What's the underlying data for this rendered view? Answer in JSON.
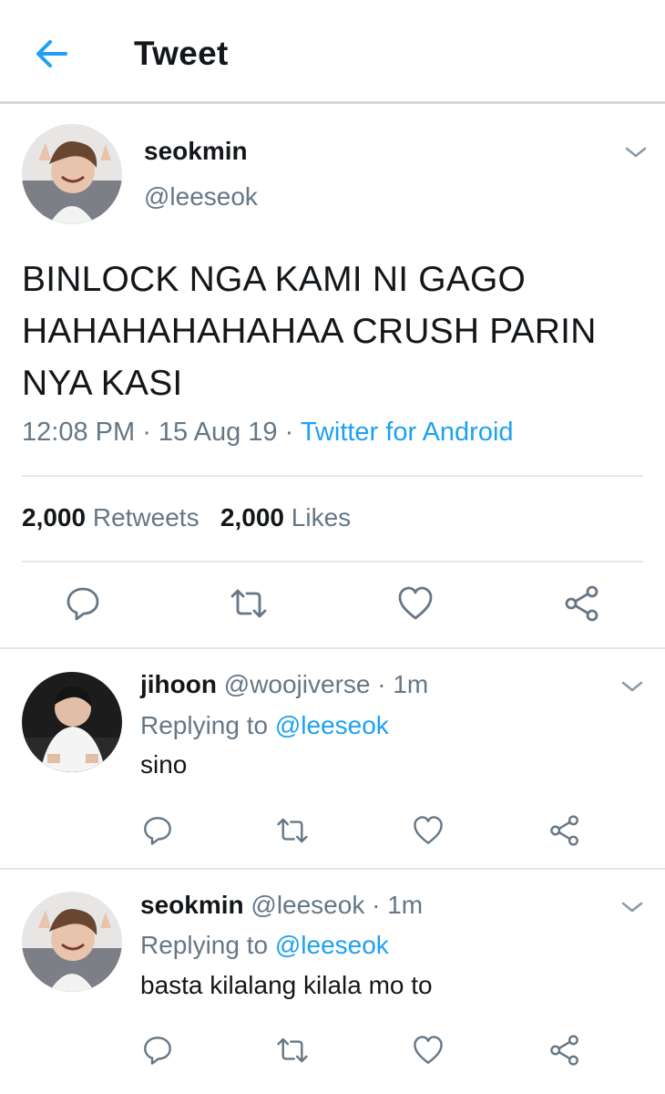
{
  "header": {
    "title": "Tweet",
    "back_icon": "arrow-left-icon",
    "accent": "#1da1f2"
  },
  "tweet": {
    "name": "seokmin",
    "handle": "@leeseok",
    "text": "BINLOCK NGA KAMI NI GAGO HAHAHAHAHAHAA CRUSH PARIN NYA KASI",
    "time": "12:08 PM",
    "dot1": " · ",
    "date": "15 Aug 19",
    "dot2": " · ",
    "source": "Twitter for Android",
    "retweets_count": "2,000",
    "retweets_label": "Retweets",
    "likes_count": "2,000",
    "likes_label": "Likes"
  },
  "replies": [
    {
      "name": "jihoon",
      "handle": "@woojiverse",
      "sep": " · ",
      "time": "1m",
      "replying_prefix": "Replying to ",
      "replying_to": "@leeseok",
      "text": "sino"
    },
    {
      "name": "seokmin",
      "handle": "@leeseok",
      "sep": " · ",
      "time": "1m",
      "replying_prefix": "Replying to ",
      "replying_to": "@leeseok",
      "text": "basta kilalang kilala mo to"
    }
  ],
  "icons": [
    "reply-icon",
    "retweet-icon",
    "like-icon",
    "share-icon",
    "chevron-down-icon"
  ]
}
